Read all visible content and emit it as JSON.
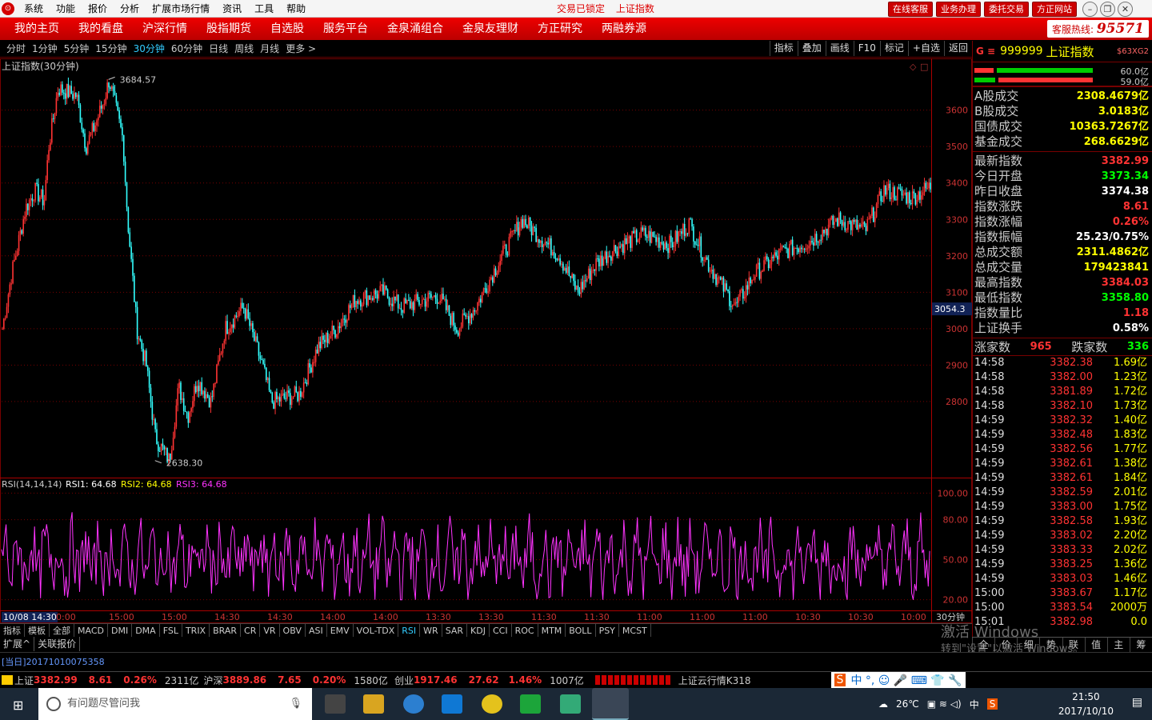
{
  "titlebar": {
    "menu": [
      "系统",
      "功能",
      "报价",
      "分析",
      "扩展市场行情",
      "资讯",
      "工具",
      "帮助"
    ],
    "status": "交易已锁定",
    "index": "上证指数",
    "buttons": [
      "在线客服",
      "业务办理",
      "委托交易",
      "方正网站"
    ]
  },
  "nav": {
    "items": [
      "我的主页",
      "我的看盘",
      "沪深行情",
      "股指期货",
      "自选股",
      "服务平台",
      "金泉涌组合",
      "金泉友理财",
      "方正研究",
      "两融券源"
    ],
    "hotline_label": "客服热线:",
    "hotline_num": "95571"
  },
  "periods": [
    "分时",
    "1分钟",
    "5分钟",
    "15分钟",
    "30分钟",
    "60分钟",
    "日线",
    "周线",
    "月线",
    "更多 >"
  ],
  "active_period": "30分钟",
  "tools": [
    "指标",
    "叠加",
    "画线",
    "F10",
    "标记",
    "+自选",
    "返回"
  ],
  "chart_data": [
    {
      "type": "line",
      "title": "上证指数(30分钟)",
      "y_ticks": [
        3600,
        3500,
        3400,
        3300,
        3200,
        3100,
        3000,
        2900,
        2800
      ],
      "ylim": [
        2600,
        3720
      ],
      "cursor_value": "3054.3",
      "high_label": "3684.57",
      "low_label": "2638.30",
      "x_labels": [
        "10/08 14:30",
        "0:00",
        "15:00",
        "15:00",
        "14:30",
        "14:30",
        "14:00",
        "14:00",
        "13:30",
        "13:30",
        "11:30",
        "11:30",
        "11:00",
        "11:00",
        "11:00",
        "10:30",
        "10:30",
        "10:00"
      ],
      "x_unit": "30分钟",
      "keypoints": [
        [
          0,
          3000
        ],
        [
          0.01,
          3150
        ],
        [
          0.025,
          3330
        ],
        [
          0.035,
          3380
        ],
        [
          0.045,
          3350
        ],
        [
          0.05,
          3500
        ],
        [
          0.06,
          3660
        ],
        [
          0.08,
          3640
        ],
        [
          0.09,
          3500
        ],
        [
          0.1,
          3560
        ],
        [
          0.11,
          3630
        ],
        [
          0.115,
          3684
        ],
        [
          0.13,
          3520
        ],
        [
          0.135,
          3300
        ],
        [
          0.145,
          3000
        ],
        [
          0.155,
          2900
        ],
        [
          0.165,
          2700
        ],
        [
          0.18,
          2638
        ],
        [
          0.19,
          2840
        ],
        [
          0.2,
          2760
        ],
        [
          0.21,
          2860
        ],
        [
          0.225,
          2800
        ],
        [
          0.24,
          3000
        ],
        [
          0.26,
          3060
        ],
        [
          0.27,
          2980
        ],
        [
          0.28,
          2900
        ],
        [
          0.29,
          2800
        ],
        [
          0.32,
          2820
        ],
        [
          0.34,
          2950
        ],
        [
          0.36,
          3000
        ],
        [
          0.38,
          3080
        ],
        [
          0.41,
          3100
        ],
        [
          0.43,
          3060
        ],
        [
          0.47,
          3090
        ],
        [
          0.49,
          3000
        ],
        [
          0.51,
          3060
        ],
        [
          0.53,
          3160
        ],
        [
          0.56,
          3300
        ],
        [
          0.6,
          3200
        ],
        [
          0.62,
          3100
        ],
        [
          0.64,
          3180
        ],
        [
          0.66,
          3220
        ],
        [
          0.69,
          3260
        ],
        [
          0.72,
          3230
        ],
        [
          0.74,
          3290
        ],
        [
          0.76,
          3180
        ],
        [
          0.79,
          3060
        ],
        [
          0.81,
          3150
        ],
        [
          0.84,
          3210
        ],
        [
          0.87,
          3240
        ],
        [
          0.9,
          3300
        ],
        [
          0.93,
          3270
        ],
        [
          0.95,
          3380
        ],
        [
          0.98,
          3360
        ],
        [
          1,
          3390
        ]
      ]
    },
    {
      "type": "line",
      "title": "RSI(14,14,14)",
      "labels": [
        "RSI1: 64.68",
        "RSI2: 64.68",
        "RSI3: 64.68"
      ],
      "y_ticks": [
        100,
        80,
        50,
        20
      ],
      "ylim": [
        15,
        105
      ],
      "color": "#ff33ff"
    }
  ],
  "indicators": [
    "指标",
    "模板",
    "全部",
    "MACD",
    "DMI",
    "DMA",
    "FSL",
    "TRIX",
    "BRAR",
    "CR",
    "VR",
    "OBV",
    "ASI",
    "EMV",
    "VOL-TDX",
    "RSI",
    "WR",
    "SAR",
    "KDJ",
    "CCI",
    "ROC",
    "MTM",
    "BOLL",
    "PSY",
    "MCST"
  ],
  "active_indicator": "RSI",
  "ext_tabs": [
    "扩展^",
    "关联报价"
  ],
  "right": {
    "code": "999999",
    "name": "上证指数",
    "tag": "$63XG2",
    "bar_vals": [
      "60.0亿",
      "59.0亿"
    ],
    "turnover": [
      [
        "A股成交",
        "2308.4679亿"
      ],
      [
        "B股成交",
        "3.0183亿"
      ],
      [
        "国债成交",
        "10363.7267亿"
      ],
      [
        "基金成交",
        "268.6629亿"
      ]
    ],
    "stats": [
      {
        "l": "最新指数",
        "v": "3382.99",
        "c": "#f33"
      },
      {
        "l": "今日开盘",
        "v": "3373.34",
        "c": "#0f0"
      },
      {
        "l": "昨日收盘",
        "v": "3374.38",
        "c": "#fff"
      },
      {
        "l": "指数涨跌",
        "v": "8.61",
        "c": "#f33"
      },
      {
        "l": "指数涨幅",
        "v": "0.26%",
        "c": "#f33"
      },
      {
        "l": "指数振幅",
        "v": "25.23/0.75%",
        "c": "#fff"
      },
      {
        "l": "总成交额",
        "v": "2311.4862亿",
        "c": "#ff0"
      },
      {
        "l": "总成交量",
        "v": "179423841",
        "c": "#ff0"
      },
      {
        "l": "最高指数",
        "v": "3384.03",
        "c": "#f33"
      },
      {
        "l": "最低指数",
        "v": "3358.80",
        "c": "#0f0"
      },
      {
        "l": "指数量比",
        "v": "1.18",
        "c": "#f33"
      },
      {
        "l": "上证换手",
        "v": "0.58%",
        "c": "#fff"
      }
    ],
    "up_label": "涨家数",
    "up": "965",
    "down_label": "跌家数",
    "down": "336",
    "ticks": [
      [
        "14:58",
        "3382.38",
        "1.69亿"
      ],
      [
        "14:58",
        "3382.00",
        "1.23亿"
      ],
      [
        "14:58",
        "3381.89",
        "1.72亿"
      ],
      [
        "14:58",
        "3382.10",
        "1.73亿"
      ],
      [
        "14:59",
        "3382.32",
        "1.40亿"
      ],
      [
        "14:59",
        "3382.48",
        "1.83亿"
      ],
      [
        "14:59",
        "3382.56",
        "1.77亿"
      ],
      [
        "14:59",
        "3382.61",
        "1.38亿"
      ],
      [
        "14:59",
        "3382.61",
        "1.84亿"
      ],
      [
        "14:59",
        "3382.59",
        "2.01亿"
      ],
      [
        "14:59",
        "3383.00",
        "1.75亿"
      ],
      [
        "14:59",
        "3382.58",
        "1.93亿"
      ],
      [
        "14:59",
        "3383.02",
        "2.20亿"
      ],
      [
        "14:59",
        "3383.33",
        "2.02亿"
      ],
      [
        "14:59",
        "3383.25",
        "1.36亿"
      ],
      [
        "14:59",
        "3383.03",
        "1.46亿"
      ],
      [
        "15:00",
        "3383.67",
        "1.17亿"
      ],
      [
        "15:00",
        "3383.54",
        "2000万"
      ],
      [
        "15:01",
        "3382.98",
        "0.0"
      ]
    ],
    "tabs": [
      "全",
      "价",
      "细",
      "势",
      "联",
      "值",
      "主",
      "筹"
    ]
  },
  "watermark": {
    "line1": "激活 Windows",
    "line2": "转到\"设置\"以激活 Windows。"
  },
  "news": "[当日]20171010075358",
  "ticker": {
    "sh_label": "上证",
    "sh": "3382.99",
    "sh_chg": "8.61",
    "sh_pct": "0.26%",
    "sh_amt": "2311亿",
    "hs_label": "沪深",
    "hs": "3889.86",
    "hs_chg": "7.65",
    "hs_pct": "0.20%",
    "hs_amt": "1580亿",
    "cy_label": "创业",
    "cy": "1917.46",
    "cy_chg": "27.62",
    "cy_pct": "1.46%",
    "cy_amt": "1007亿",
    "cloud": "上证云行情K318"
  },
  "taskbar": {
    "search": "有问题尽管问我",
    "temp": "26℃",
    "ime": "中",
    "time": "21:50",
    "date": "2017/10/10"
  }
}
